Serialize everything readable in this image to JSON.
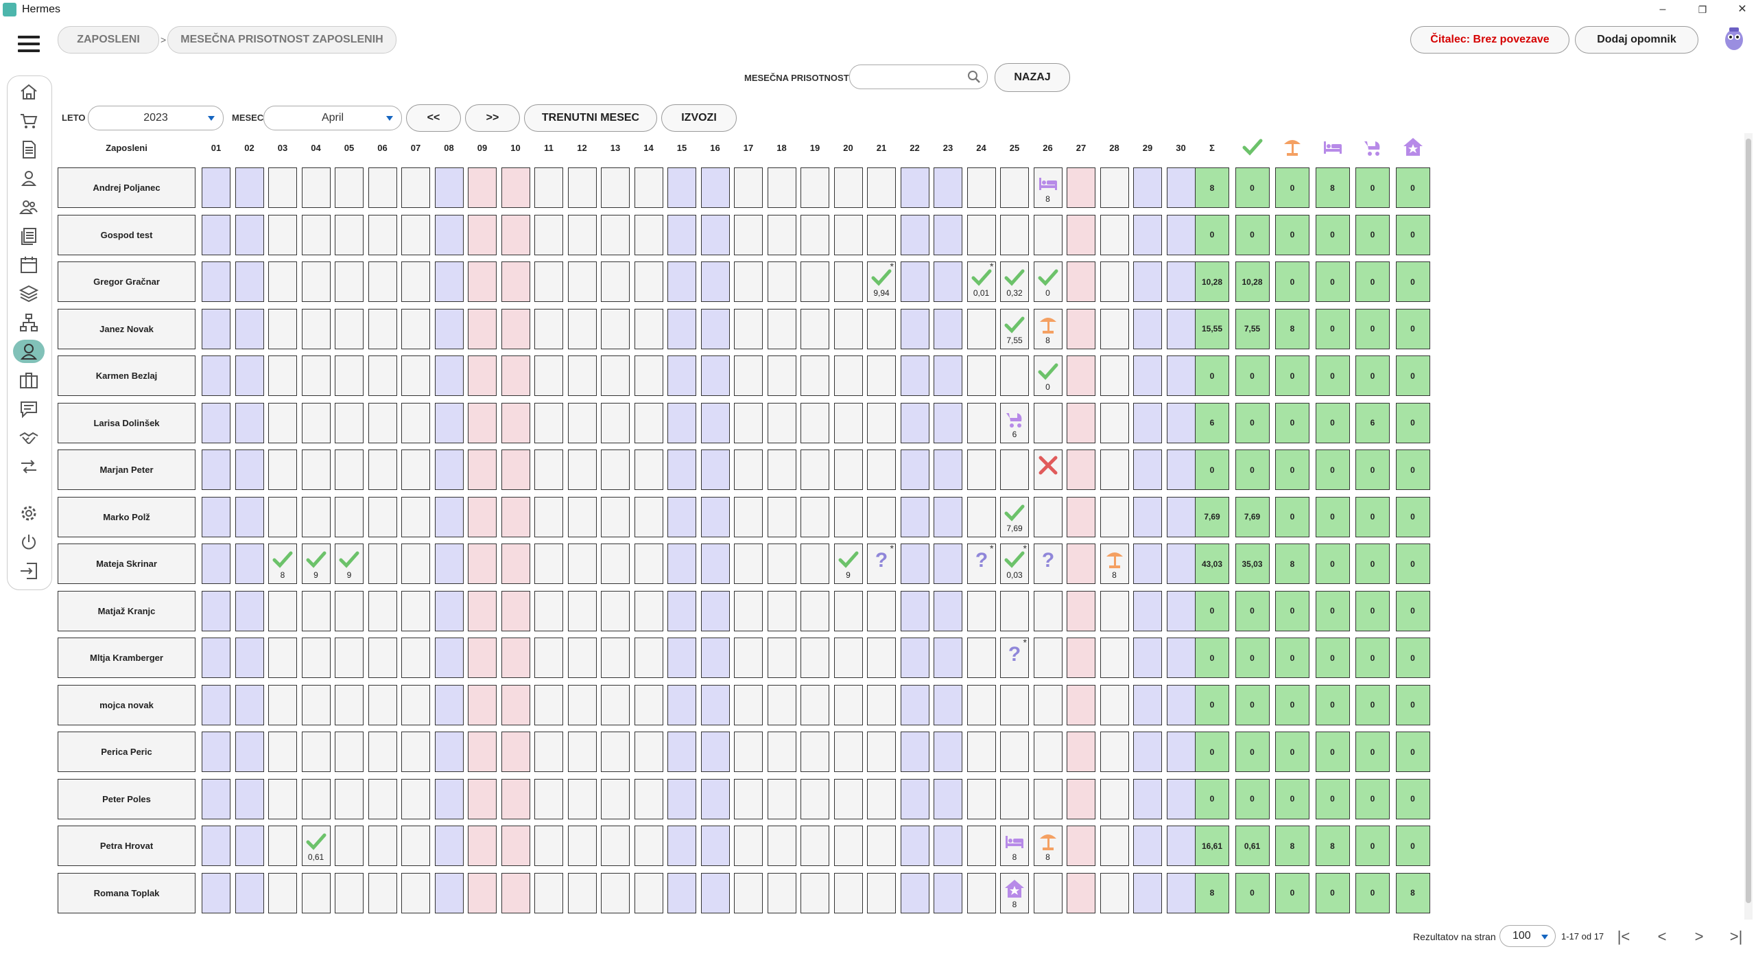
{
  "window": {
    "title": "Hermes",
    "minimize": "–",
    "restore": "❐",
    "close": "✕"
  },
  "breadcrumb": {
    "items": [
      "ZAPOSLENI",
      "MESEČNA PRISOTNOST ZAPOSLENIH"
    ],
    "separator": ">"
  },
  "header_actions": {
    "reader": "Čitalec: Brez povezave",
    "reminder": "Dodaj opomnik"
  },
  "sidebar": {
    "items": [
      "home-icon",
      "cart-icon",
      "document-icon",
      "person-icon",
      "group-icon",
      "files-icon",
      "calendar-icon",
      "layers-icon",
      "network-icon",
      "attendance-icon",
      "briefcase-icon",
      "chat-icon",
      "handshake-icon",
      "transfer-icon",
      "settings-icon",
      "power-icon",
      "logout-icon"
    ],
    "active": "attendance-icon"
  },
  "search": {
    "label": "MESEČNA PRISOTNOST",
    "value": "",
    "placeholder": "",
    "back": "NAZAJ"
  },
  "filters": {
    "year_label": "LETO",
    "year": "2023",
    "month_label": "MESEC",
    "month": "April",
    "prev": "<<",
    "next": ">>",
    "current": "TRENUTNI MESEC",
    "export": "IZVOZI"
  },
  "colors": {
    "weekend": "#dcdcf8",
    "holiday": "#f6dce0",
    "summary": "#a7e3a4",
    "present": "#6cc26a",
    "vacation": "#f4a062",
    "sick": "#b78ae8",
    "maternity": "#b78ae8",
    "home": "#b78ae8",
    "unknown": "#8f86d9",
    "absent": "#e05a5a"
  },
  "grid": {
    "name_header": "Zaposleni",
    "sum_header": "Σ",
    "days": [
      "01",
      "02",
      "03",
      "04",
      "05",
      "06",
      "07",
      "08",
      "09",
      "10",
      "11",
      "12",
      "13",
      "14",
      "15",
      "16",
      "17",
      "18",
      "19",
      "20",
      "21",
      "22",
      "23",
      "24",
      "25",
      "26",
      "27",
      "28",
      "29",
      "30"
    ],
    "day_types": [
      "w",
      "w",
      "",
      "",
      "",
      "",
      "",
      "w",
      "h",
      "h",
      "",
      "",
      "",
      "",
      "w",
      "w",
      "",
      "",
      "",
      "",
      "",
      "w",
      "w",
      "",
      "",
      "",
      "h",
      "",
      "w",
      "w"
    ],
    "summary_icons": [
      "check-icon",
      "vacation-icon",
      "sick-icon",
      "maternity-icon",
      "home-icon"
    ],
    "rows": [
      {
        "name": "Andrej Poljanec",
        "cells": {
          "26": {
            "icon": "sick",
            "value": "8"
          }
        },
        "totals": [
          "8",
          "0",
          "0",
          "8",
          "0",
          "0"
        ]
      },
      {
        "name": "Gospod test",
        "cells": {},
        "totals": [
          "0",
          "0",
          "0",
          "0",
          "0",
          "0"
        ]
      },
      {
        "name": "Gregor Gračnar",
        "cells": {
          "21": {
            "icon": "check",
            "value": "9,94",
            "star": "*"
          },
          "24": {
            "icon": "check",
            "value": "0,01",
            "star": "*"
          },
          "25": {
            "icon": "check",
            "value": "0,32"
          },
          "26": {
            "icon": "check",
            "value": "0"
          }
        },
        "totals": [
          "10,28",
          "10,28",
          "0",
          "0",
          "0",
          "0"
        ]
      },
      {
        "name": "Janez Novak",
        "cells": {
          "25": {
            "icon": "check",
            "value": "7,55"
          },
          "26": {
            "icon": "vacation",
            "value": "8"
          }
        },
        "totals": [
          "15,55",
          "7,55",
          "8",
          "0",
          "0",
          "0"
        ]
      },
      {
        "name": "Karmen Bezlaj",
        "cells": {
          "26": {
            "icon": "check",
            "value": "0"
          }
        },
        "totals": [
          "0",
          "0",
          "0",
          "0",
          "0",
          "0"
        ]
      },
      {
        "name": "Larisa Dolinšek",
        "cells": {
          "25": {
            "icon": "maternity",
            "value": "6"
          }
        },
        "totals": [
          "6",
          "0",
          "0",
          "0",
          "6",
          "0"
        ]
      },
      {
        "name": "Marjan Peter",
        "cells": {
          "26": {
            "icon": "absent",
            "value": ""
          }
        },
        "totals": [
          "0",
          "0",
          "0",
          "0",
          "0",
          "0"
        ]
      },
      {
        "name": "Marko Polž",
        "cells": {
          "25": {
            "icon": "check",
            "value": "7,69"
          }
        },
        "totals": [
          "7,69",
          "7,69",
          "0",
          "0",
          "0",
          "0"
        ]
      },
      {
        "name": "Mateja Skrinar",
        "cells": {
          "03": {
            "icon": "check",
            "value": "8"
          },
          "04": {
            "icon": "check",
            "value": "9"
          },
          "05": {
            "icon": "check",
            "value": "9"
          },
          "20": {
            "icon": "check",
            "value": "9"
          },
          "21": {
            "icon": "unknown",
            "value": "",
            "star": "*"
          },
          "24": {
            "icon": "unknown",
            "value": "",
            "star": "*"
          },
          "25": {
            "icon": "check",
            "value": "0,03",
            "star": "*"
          },
          "26": {
            "icon": "unknown",
            "value": ""
          },
          "28": {
            "icon": "vacation",
            "value": "8"
          }
        },
        "totals": [
          "43,03",
          "35,03",
          "8",
          "0",
          "0",
          "0"
        ]
      },
      {
        "name": "Matjaž Kranjc",
        "cells": {},
        "totals": [
          "0",
          "0",
          "0",
          "0",
          "0",
          "0"
        ]
      },
      {
        "name": "Mltja Kramberger",
        "cells": {
          "25": {
            "icon": "unknown",
            "value": "",
            "star": "*"
          }
        },
        "totals": [
          "0",
          "0",
          "0",
          "0",
          "0",
          "0"
        ]
      },
      {
        "name": "mojca novak",
        "cells": {},
        "totals": [
          "0",
          "0",
          "0",
          "0",
          "0",
          "0"
        ]
      },
      {
        "name": "Perica Peric",
        "cells": {},
        "totals": [
          "0",
          "0",
          "0",
          "0",
          "0",
          "0"
        ]
      },
      {
        "name": "Peter Poles",
        "cells": {},
        "totals": [
          "0",
          "0",
          "0",
          "0",
          "0",
          "0"
        ]
      },
      {
        "name": "Petra Hrovat",
        "cells": {
          "04": {
            "icon": "check",
            "value": "0,61"
          },
          "25": {
            "icon": "sick",
            "value": "8"
          },
          "26": {
            "icon": "vacation",
            "value": "8"
          }
        },
        "totals": [
          "16,61",
          "0,61",
          "8",
          "8",
          "0",
          "0"
        ]
      },
      {
        "name": "Romana Toplak",
        "cells": {
          "25": {
            "icon": "home",
            "value": "8"
          }
        },
        "totals": [
          "8",
          "0",
          "0",
          "0",
          "0",
          "8"
        ]
      }
    ]
  },
  "footer": {
    "per_page_label": "Rezultatov na stran",
    "per_page": "100",
    "range": "1-17 od 17",
    "first": "|<",
    "prev": "<",
    "next": ">",
    "last": ">|"
  }
}
